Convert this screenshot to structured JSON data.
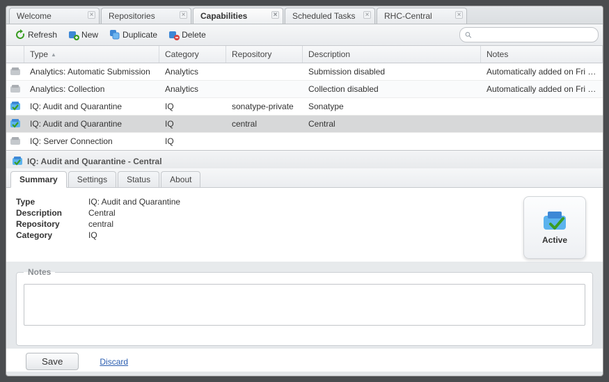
{
  "tabs": [
    {
      "label": "Welcome"
    },
    {
      "label": "Repositories"
    },
    {
      "label": "Capabilities",
      "active": true
    },
    {
      "label": "Scheduled Tasks"
    },
    {
      "label": "RHC-Central"
    }
  ],
  "toolbar": {
    "refresh": "Refresh",
    "new": "New",
    "duplicate": "Duplicate",
    "delete": "Delete",
    "search_placeholder": ""
  },
  "columns": {
    "type": "Type",
    "category": "Category",
    "repository": "Repository",
    "description": "Description",
    "notes": "Notes"
  },
  "rows": [
    {
      "type": "Analytics: Automatic Submission",
      "category": "Analytics",
      "repository": "",
      "description": "Submission disabled",
      "notes": "Automatically added on Fri Dec ...",
      "status": "plain"
    },
    {
      "type": "Analytics: Collection",
      "category": "Analytics",
      "repository": "",
      "description": "Collection disabled",
      "notes": "Automatically added on Fri Dec ...",
      "status": "plain"
    },
    {
      "type": "IQ: Audit and Quarantine",
      "category": "IQ",
      "repository": "sonatype-private",
      "description": "Sonatype",
      "notes": "",
      "status": "active"
    },
    {
      "type": "IQ: Audit and Quarantine",
      "category": "IQ",
      "repository": "central",
      "description": "Central",
      "notes": "",
      "status": "active",
      "selected": true
    },
    {
      "type": "IQ: Server Connection",
      "category": "IQ",
      "repository": "",
      "description": "",
      "notes": "",
      "status": "plain"
    }
  ],
  "detail": {
    "title": "IQ: Audit and Quarantine - Central",
    "tabs": [
      "Summary",
      "Settings",
      "Status",
      "About"
    ],
    "summary": {
      "Type": "IQ: Audit and Quarantine",
      "Description": "Central",
      "Repository": "central",
      "Category": "IQ"
    },
    "status_label": "Active",
    "notes_legend": "Notes",
    "save": "Save",
    "discard": "Discard"
  }
}
